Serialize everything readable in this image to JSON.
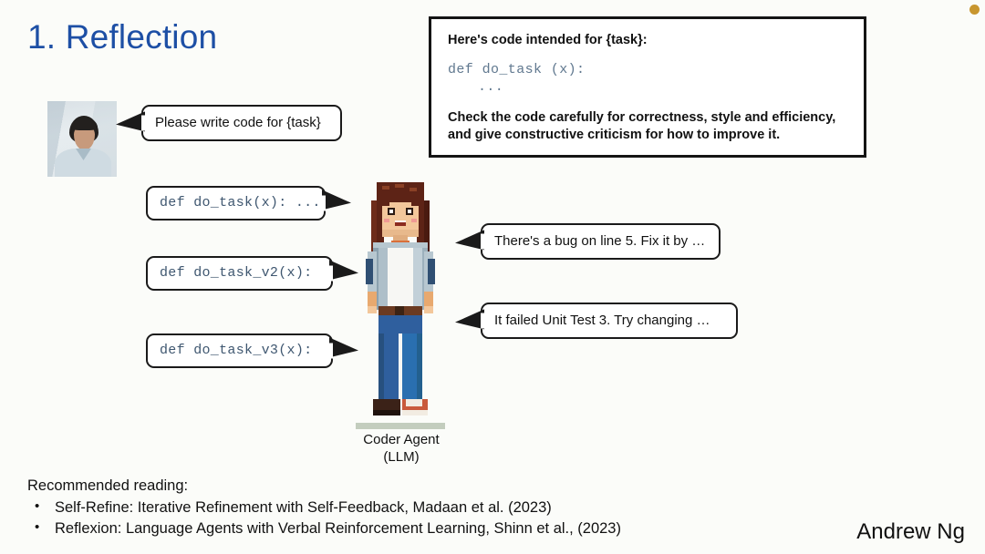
{
  "slide": {
    "title": "1. Reflection",
    "signature": "Andrew Ng"
  },
  "human": {
    "bubble_text": "Please write code for {task}"
  },
  "prompt_box": {
    "intro": "Here's code intended for {task}:",
    "code_line": "def do_task (x):",
    "code_body": "...",
    "instruction_line_1": "Check the code carefully for correctness, style and efficiency,",
    "instruction_line_2": "and give constructive criticism for how to improve it."
  },
  "code_bubbles": [
    {
      "text": "def do_task(x): ..."
    },
    {
      "text": "def do_task_v2(x):"
    },
    {
      "text": "def do_task_v3(x):"
    }
  ],
  "critique_bubbles": [
    {
      "text": "There's a bug on line 5. Fix it by …"
    },
    {
      "text": "It failed Unit Test 3. Try changing …"
    }
  ],
  "agent": {
    "caption_line_1": "Coder Agent",
    "caption_line_2": "(LLM)"
  },
  "footer": {
    "heading": "Recommended reading:",
    "items": [
      "Self-Refine: Iterative Refinement with Self-Feedback, Madaan et al. (2023)",
      "Reflexion: Language Agents with Verbal Reinforcement Learning, Shinn et al., (2023)"
    ]
  },
  "colors": {
    "title_blue": "#1d4fa5",
    "code_blue": "#3f5770",
    "prompt_code_blue": "#60788f",
    "background": "#fbfcf9",
    "outline": "#1a1a1a",
    "corner_dot": "#c8962e"
  }
}
